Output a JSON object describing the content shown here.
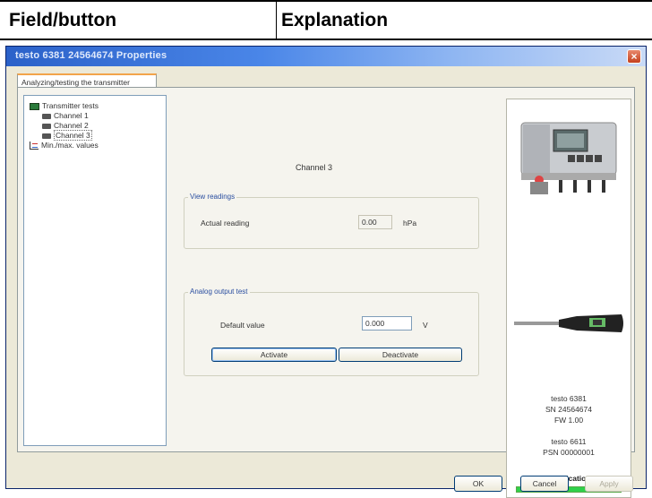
{
  "table_header": {
    "col1": "Field/button",
    "col2": "Explanation"
  },
  "window": {
    "title": "testo 6381  24564674 Properties",
    "close_label": "×"
  },
  "tab": {
    "label": "Analyzing/testing the transmitter"
  },
  "tree": {
    "items": [
      {
        "label": "Transmitter tests",
        "icon": "transmitter-icon"
      },
      {
        "label": "Channel 1",
        "icon": "channel-icon"
      },
      {
        "label": "Channel 2",
        "icon": "channel-icon"
      },
      {
        "label": "Channel 3",
        "icon": "channel-icon",
        "selected": true
      },
      {
        "label": "Min./max. values",
        "icon": "minmax-icon"
      }
    ]
  },
  "content": {
    "channel_title": "Channel 3",
    "view_readings": {
      "group_title": "View readings",
      "label": "Actual reading",
      "value": "0.00",
      "unit": "hPa"
    },
    "analog_output": {
      "group_title": "Analog output test",
      "label": "Default value",
      "value": "0.000",
      "unit": "V",
      "activate_label": "Activate",
      "deactivate_label": "Deactivate"
    }
  },
  "device": {
    "model": "testo 6381",
    "serial": "SN 24564674",
    "firmware": "FW 1.00",
    "probe_model": "testo 6611",
    "probe_serial": "PSN 00000001",
    "status": "Communication OK",
    "status_color": "#2fd04a"
  },
  "buttons": {
    "ok": "OK",
    "cancel": "Cancel",
    "apply": "Apply"
  }
}
